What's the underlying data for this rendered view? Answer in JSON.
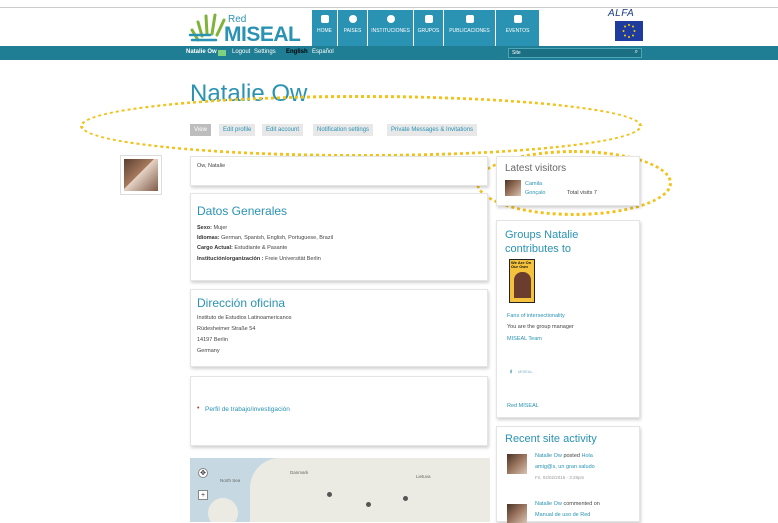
{
  "brand": {
    "red": "Red",
    "miseal": "MISEAL",
    "eu_alfa": "ALFA"
  },
  "nav": [
    {
      "label": "HOME"
    },
    {
      "label": "PAISES"
    },
    {
      "label": "INSTITUCIONES"
    },
    {
      "label": "GRUPOS"
    },
    {
      "label": "PUBLICACIONES"
    },
    {
      "label": "EVENTOS"
    }
  ],
  "topbar": {
    "user": "Natalie Ow",
    "logout": "Logout",
    "settings": "Settings",
    "english": "English",
    "espanol": "Español",
    "search_select": "Site",
    "search_icon": "⌕"
  },
  "profile": {
    "name": "Natalie Ow",
    "tabs": [
      "View",
      "Edit profile",
      "Edit account",
      "Notification settings",
      "Private Messages & Invitations"
    ],
    "display_name": "Ow, Natalie"
  },
  "datos": {
    "heading": "Datos Generales",
    "sexo_label": "Sexo:",
    "sexo": "Mujer",
    "idiomas_label": "Idiomas:",
    "idiomas": "German, Spanish, English, Portuguese, Brazil",
    "cargo_label": "Cargo Actual:",
    "cargo": "Estudiante & Pasante",
    "inst_label": "Institución/organización :",
    "inst": "Freie Universität Berlin"
  },
  "oficina": {
    "heading": "Dirección oficina",
    "lines": [
      "Instituto de Estudios Latinoamericanos",
      "Rüdesheimer Straße 54",
      "14197 Berlin",
      "Germany"
    ]
  },
  "perfil": {
    "link": "Perfil de trabajo/investigación"
  },
  "visitors": {
    "heading": "Latest visitors",
    "name_line1": "Camila",
    "name_line2": "Gonçalo",
    "total": "Total visits 7"
  },
  "groups": {
    "heading_line1": "Groups Natalie",
    "heading_line2": "contributes to",
    "book_text": "We Are On Our Own",
    "group1": "Fans of intersectionality",
    "manager": "You are the group manager",
    "group2": "MISEAL Team",
    "small_logo": "MISEAL",
    "group3": "Red MISEAL"
  },
  "activity": {
    "heading": "Recent site activity",
    "item1_user": "Natalie Ow",
    "item1_verb": "posted",
    "item1_link1": "Hola",
    "item1_link2": "amig@s, un gran saludo",
    "item1_date": "Fri, 02/02/2016 - 3:29pm",
    "item2_user": "Natalie Ow",
    "item2_verb": "commented on",
    "item2_link": "Manual de uso de Red"
  },
  "map": {
    "label_north_sea": "North Sea",
    "label_denmark": "Danmark",
    "label_lietuva": "Lietuva"
  },
  "colors": {
    "accent": "#2a93b3",
    "bar": "#1f7e93",
    "highlight": "#f1c21a"
  }
}
